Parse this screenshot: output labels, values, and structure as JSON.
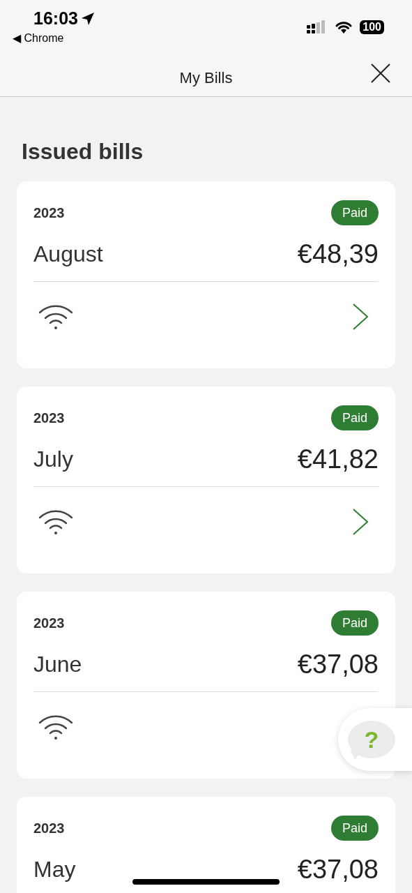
{
  "status_bar": {
    "time": "16:03",
    "back_app": "◀ Chrome",
    "battery": "100"
  },
  "nav": {
    "title": "My Bills"
  },
  "section_title": "Issued bills",
  "bills": [
    {
      "year": "2023",
      "status": "Paid",
      "month": "August",
      "amount": "€48,39"
    },
    {
      "year": "2023",
      "status": "Paid",
      "month": "July",
      "amount": "€41,82"
    },
    {
      "year": "2023",
      "status": "Paid",
      "month": "June",
      "amount": "€37,08"
    },
    {
      "year": "2023",
      "status": "Paid",
      "month": "May",
      "amount": "€37,08"
    }
  ],
  "help": {
    "label": "?"
  }
}
